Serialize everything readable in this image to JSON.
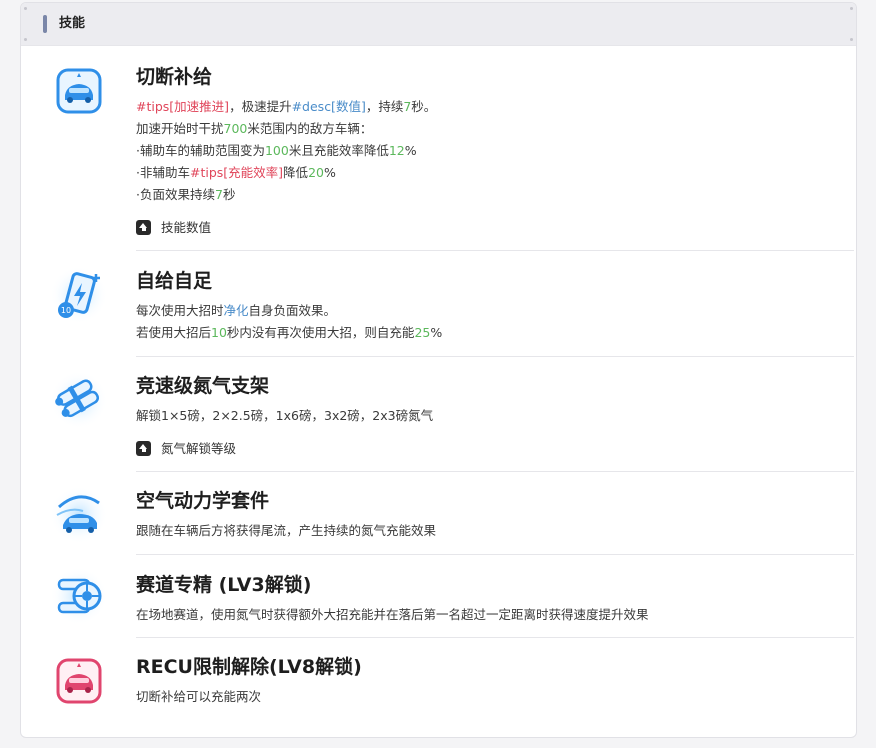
{
  "panel": {
    "title": "技能"
  },
  "skills": [
    {
      "name": "切断补给",
      "lines": [
        [
          {
            "t": "#tips[加速推进]",
            "c": "tip"
          },
          {
            "t": "，极速提升"
          },
          {
            "t": "#desc[数值]",
            "c": "desc"
          },
          {
            "t": "，持续"
          },
          {
            "t": "7",
            "c": "num"
          },
          {
            "t": "秒。"
          }
        ],
        [
          {
            "t": "加速开始时干扰"
          },
          {
            "t": "700",
            "c": "num"
          },
          {
            "t": "米范围内的敌方车辆："
          }
        ],
        [
          {
            "t": "·辅助车的辅助范围变为"
          },
          {
            "t": "100",
            "c": "num"
          },
          {
            "t": "米且充能效率降低"
          },
          {
            "t": "12",
            "c": "num"
          },
          {
            "t": "%"
          }
        ],
        [
          {
            "t": "·非辅助车"
          },
          {
            "t": "#tips[充能效率]",
            "c": "tip"
          },
          {
            "t": "降低"
          },
          {
            "t": "20",
            "c": "num"
          },
          {
            "t": "%"
          }
        ],
        [
          {
            "t": "·负面效果持续"
          },
          {
            "t": "7",
            "c": "num"
          },
          {
            "t": "秒"
          }
        ]
      ],
      "sub_button": "技能数值",
      "icon": "car-boost-icon",
      "icon_color": "#2f8fe8"
    },
    {
      "name": "自给自足",
      "lines": [
        [
          {
            "t": "每次使用大招时"
          },
          {
            "t": "净化",
            "c": "desc"
          },
          {
            "t": "自身负面效果。"
          }
        ],
        [
          {
            "t": "若使用大招后"
          },
          {
            "t": "10",
            "c": "num"
          },
          {
            "t": "秒内没有再次使用大招，则自充能"
          },
          {
            "t": "25",
            "c": "num"
          },
          {
            "t": "%"
          }
        ]
      ],
      "icon": "battery-charge-icon",
      "icon_color": "#2f8fe8"
    },
    {
      "name": "竞速级氮气支架",
      "lines": [
        [
          {
            "t": "解锁1×5磅，2×2.5磅，1x6磅，3x2磅，2x3磅氮气"
          }
        ]
      ],
      "sub_button": "氮气解锁等级",
      "icon": "nitro-tanks-icon",
      "icon_color": "#2f8fe8"
    },
    {
      "name": "空气动力学套件",
      "lines": [
        [
          {
            "t": "跟随在车辆后方将获得尾流，产生持续的氮气充能效果"
          }
        ]
      ],
      "icon": "aero-car-icon",
      "icon_color": "#2f8fe8"
    },
    {
      "name": "赛道专精 (LV3解锁)",
      "lines": [
        [
          {
            "t": "在场地赛道，使用氮气时获得额外大招充能并在落后第一名超过一定距离时获得速度提升效果"
          }
        ]
      ],
      "icon": "tire-track-icon",
      "icon_color": "#2f8fe8"
    },
    {
      "name": "RECU限制解除(LV8解锁)",
      "lines": [
        [
          {
            "t": "切断补给可以充能两次"
          }
        ]
      ],
      "icon": "car-boost-pink-icon",
      "icon_color": "#e0456e"
    }
  ]
}
